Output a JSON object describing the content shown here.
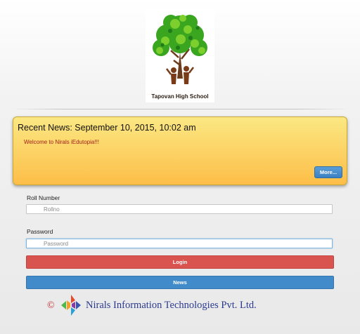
{
  "logo": {
    "caption": "Tapovan High School",
    "icon": "tree-with-children-logo-icon"
  },
  "news": {
    "title": "Recent News: September 10, 2015, 10:02 am",
    "body": "Welcome to Nirals iEdutopia!!!",
    "more_label": "More..."
  },
  "form": {
    "rollno_label": "Roll Number",
    "rollno_placeholder": "Rollno",
    "password_label": "Password",
    "password_placeholder": "Password",
    "login_label": "Login",
    "news_label": "News"
  },
  "footer": {
    "copyright_symbol": "©",
    "company": "Nirals Information Technologies Pvt. Ltd.",
    "icon": "nirals-logo-icon"
  },
  "colors": {
    "login": "#d9534f",
    "news_button": "#428bca",
    "news_box_top": "#fbe883",
    "news_box_bottom": "#fdbe48",
    "company_text": "#2b3a8f"
  }
}
